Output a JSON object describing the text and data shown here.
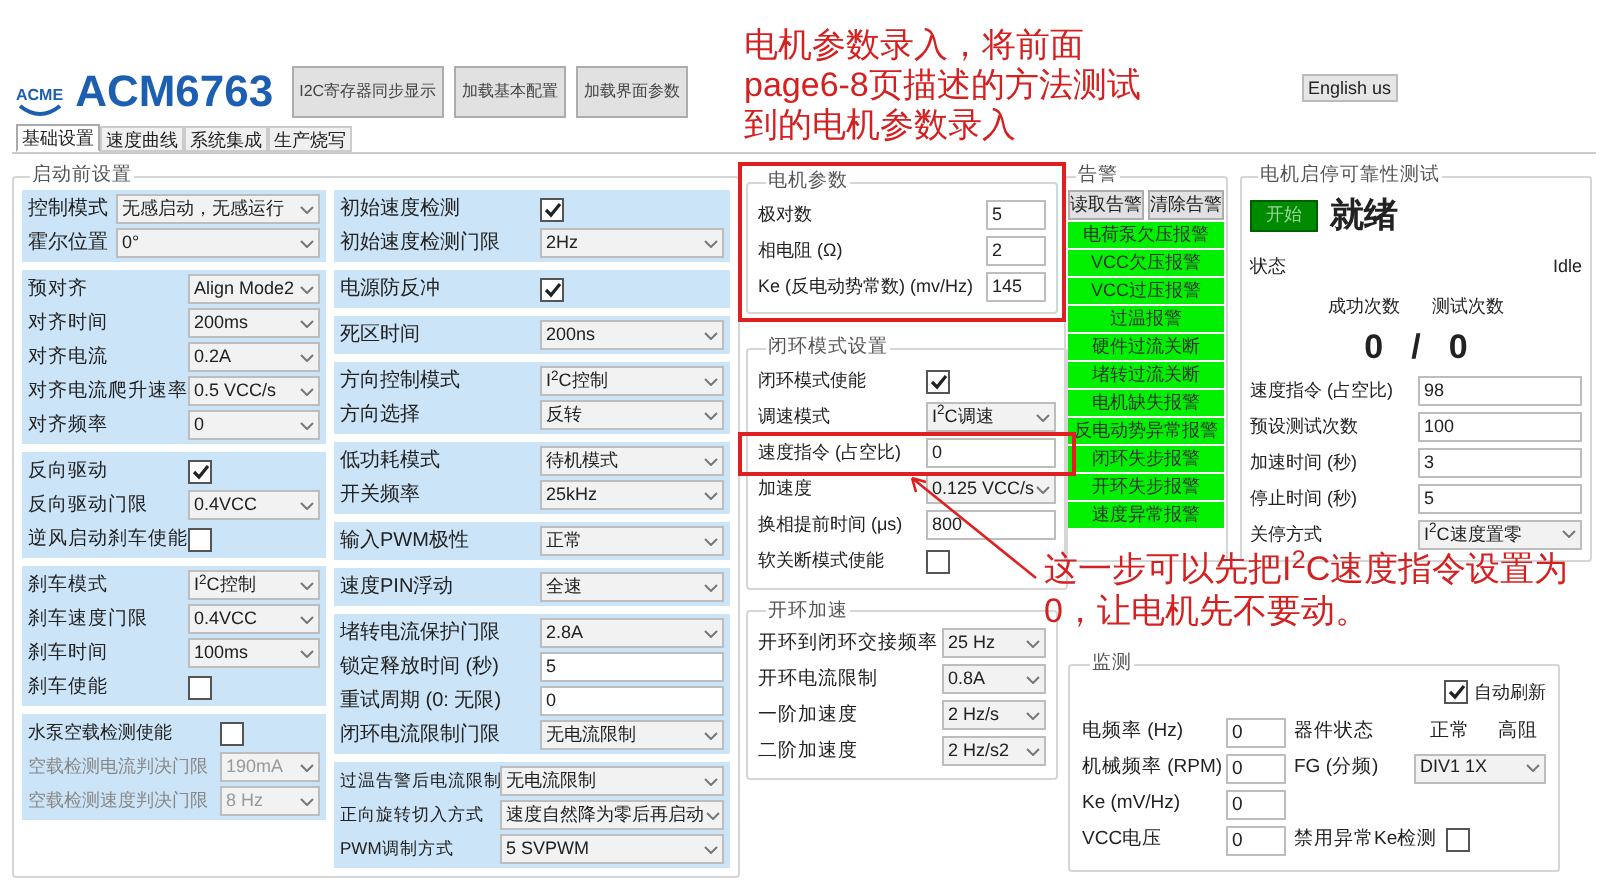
{
  "header": {
    "logo_mark": "ACME",
    "product": "ACM6763",
    "buttons": [
      "I2C寄存器同步显示",
      "加载基本配置",
      "加载界面参数"
    ],
    "language_button": "English us"
  },
  "tabs": [
    {
      "label": "基础设置",
      "selected": true
    },
    {
      "label": "速度曲线",
      "selected": false
    },
    {
      "label": "系统集成",
      "selected": false
    },
    {
      "label": "生产烧写",
      "selected": false
    }
  ],
  "startup_settings": {
    "title": "启动前设置",
    "column_1": [
      {
        "rows": [
          {
            "label": "控制模式",
            "kind": "select",
            "value": "无感启动，无感运行"
          },
          {
            "label": "霍尔位置",
            "kind": "select",
            "value": "0°"
          }
        ]
      },
      {
        "rows": [
          {
            "label": "预对齐",
            "kind": "select",
            "value": "Align Mode2"
          },
          {
            "label": "对齐时间",
            "kind": "select",
            "value": "200ms"
          },
          {
            "label": "对齐电流",
            "kind": "select",
            "value": "0.2A"
          },
          {
            "label": "对齐电流爬升速率",
            "kind": "select",
            "value": "0.5 VCC/s"
          },
          {
            "label": "对齐频率",
            "kind": "select",
            "value": "0"
          }
        ]
      },
      {
        "rows": [
          {
            "label": "反向驱动",
            "kind": "check",
            "checked": true
          },
          {
            "label": "反向驱动门限",
            "kind": "select",
            "value": "0.4VCC"
          },
          {
            "label": "逆风启动刹车使能",
            "kind": "check",
            "checked": false
          }
        ]
      },
      {
        "rows": [
          {
            "label": "刹车模式",
            "kind": "select",
            "value": "I$^{2}$C控制"
          },
          {
            "label": "刹车速度门限",
            "kind": "select",
            "value": "0.4VCC"
          },
          {
            "label": "刹车时间",
            "kind": "select",
            "value": "100ms"
          },
          {
            "label": "刹车使能",
            "kind": "check",
            "checked": false
          }
        ]
      },
      {
        "rows": [
          {
            "label": "水泵空载检测使能",
            "kind": "check",
            "checked": false,
            "disabled": false
          },
          {
            "label": "空载检测电流判决门限",
            "kind": "select",
            "value": "190mA",
            "disabled": true
          },
          {
            "label": "空载检测速度判决门限",
            "kind": "select",
            "value": "8 Hz",
            "disabled": true
          }
        ]
      }
    ],
    "column_2": [
      {
        "rows": [
          {
            "label": "初始速度检测",
            "kind": "check",
            "checked": true
          },
          {
            "label": "初始速度检测门限",
            "kind": "select",
            "value": "2Hz"
          }
        ]
      },
      {
        "rows": [
          {
            "label": "电源防反冲",
            "kind": "check",
            "checked": true
          }
        ]
      },
      {
        "rows": [
          {
            "label": "死区时间",
            "kind": "select",
            "value": "200ns"
          }
        ]
      },
      {
        "rows": [
          {
            "label": "方向控制模式",
            "kind": "select",
            "value": "I$^{2}$C控制"
          },
          {
            "label": "方向选择",
            "kind": "select",
            "value": "反转"
          }
        ]
      },
      {
        "rows": [
          {
            "label": "低功耗模式",
            "kind": "select",
            "value": "待机模式"
          },
          {
            "label": "开关频率",
            "kind": "select",
            "value": "25kHz"
          }
        ]
      },
      {
        "rows": [
          {
            "label": "输入PWM极性",
            "kind": "select",
            "value": "正常"
          }
        ]
      },
      {
        "rows": [
          {
            "label": "速度PIN浮动",
            "kind": "select",
            "value": "全速"
          }
        ]
      },
      {
        "rows": [
          {
            "label": "堵转电流保护门限",
            "kind": "select",
            "value": "2.8A"
          },
          {
            "label": "锁定释放时间 (秒)",
            "kind": "text",
            "value": "5"
          },
          {
            "label": "重试周期 (0: 无限)",
            "kind": "text",
            "value": "0"
          },
          {
            "label": "闭环电流限制门限",
            "kind": "select",
            "value": "无电流限制"
          }
        ]
      },
      {
        "rows": [
          {
            "label": "过温告警后电流限制",
            "kind": "select",
            "value": "无电流限制"
          },
          {
            "label": "正向旋转切入方式",
            "kind": "select",
            "value": "速度自然降为零后再启动"
          },
          {
            "label": "PWM调制方式",
            "kind": "select",
            "value": "5 SVPWM"
          }
        ]
      }
    ]
  },
  "motor_params": {
    "title": "电机参数",
    "rows": [
      {
        "label": "极对数",
        "kind": "text",
        "value": "5"
      },
      {
        "label": "相电阻 (Ω)",
        "kind": "text",
        "value": "2"
      },
      {
        "label": "Ke (反电动势常数) (mv/Hz)",
        "kind": "text",
        "value": "145"
      }
    ]
  },
  "closed_loop": {
    "title": "闭环模式设置",
    "rows": [
      {
        "label": "闭环模式使能",
        "kind": "check",
        "checked": true
      },
      {
        "label": "调速模式",
        "kind": "select",
        "value": "I$^{2}$C调速"
      },
      {
        "label": "速度指令 (占空比)",
        "kind": "text",
        "value": "0"
      },
      {
        "label": "加速度",
        "kind": "select",
        "value": "0.125 VCC/s"
      },
      {
        "label": "换相提前时间 (μs)",
        "kind": "text",
        "value": "800"
      },
      {
        "label": "软关断模式使能",
        "kind": "check",
        "checked": false
      }
    ]
  },
  "open_loop": {
    "title": "开环加速",
    "rows": [
      {
        "label": "开环到闭环交接频率",
        "kind": "select",
        "value": "25 Hz"
      },
      {
        "label": "开环电流限制",
        "kind": "select",
        "value": "0.8A"
      },
      {
        "label": "一阶加速度",
        "kind": "select",
        "value": "2 Hz/s"
      },
      {
        "label": "二阶加速度",
        "kind": "select",
        "value": "2 Hz/s2"
      }
    ]
  },
  "alarms": {
    "title": "告警",
    "buttons": [
      "读取告警",
      "清除告警"
    ],
    "items": [
      {
        "label": "电荷泵欠压报警",
        "active": true
      },
      {
        "label": "VCC欠压报警",
        "active": true
      },
      {
        "label": "VCC过压报警",
        "active": true
      },
      {
        "label": "过温报警",
        "active": true
      },
      {
        "label": "硬件过流关断",
        "active": true
      },
      {
        "label": "堵转过流关断",
        "active": true
      },
      {
        "label": "电机缺失报警",
        "active": true
      },
      {
        "label": "反电动势异常报警",
        "active": true
      },
      {
        "label": "闭环失步报警",
        "active": true
      },
      {
        "label": "开环失步报警",
        "active": true
      },
      {
        "label": "速度异常报警",
        "active": true
      }
    ]
  },
  "reliability_test": {
    "title": "电机启停可靠性测试",
    "start_button": "开始",
    "state": "就绪",
    "status_label": "状态",
    "status_value": "Idle",
    "success_label": "成功次数",
    "total_label": "测试次数",
    "success_count": "0",
    "separator": "/",
    "total_count": "0",
    "rows": [
      {
        "label": "速度指令 (占空比)",
        "kind": "text",
        "value": "98"
      },
      {
        "label": "预设测试次数",
        "kind": "text",
        "value": "100"
      },
      {
        "label": "加速时间 (秒)",
        "kind": "text",
        "value": "3"
      },
      {
        "label": "停止时间 (秒)",
        "kind": "text",
        "value": "5"
      },
      {
        "label": "关停方式",
        "kind": "select",
        "value": "I$^{2}$C速度置零"
      }
    ]
  },
  "monitor": {
    "title": "监测",
    "auto_refresh": {
      "label": "自动刷新",
      "checked": true
    },
    "rows": [
      {
        "label": "电频率 (Hz)",
        "value": "0",
        "extra": {
          "kind": "status",
          "label": "器件状态",
          "values": [
            "正常",
            "高阻"
          ]
        }
      },
      {
        "label": "机械频率 (RPM)",
        "value": "0",
        "extra": {
          "kind": "select",
          "label": "FG (分频)",
          "value": "DIV1 1X"
        }
      },
      {
        "label": "Ke (mV/Hz)",
        "value": "0"
      },
      {
        "label": "VCC电压",
        "value": "0",
        "extra": {
          "kind": "check",
          "label": "禁用异常Ke检测",
          "checked": false
        }
      }
    ]
  },
  "annotations": [
    {
      "text": "电机参数录入，将前面page6-8页描述的方法测试到的电机参数录入"
    },
    {
      "text": "这一步可以先把I$^{2}$C速度指令设置为0，让电机先不要动。"
    }
  ]
}
